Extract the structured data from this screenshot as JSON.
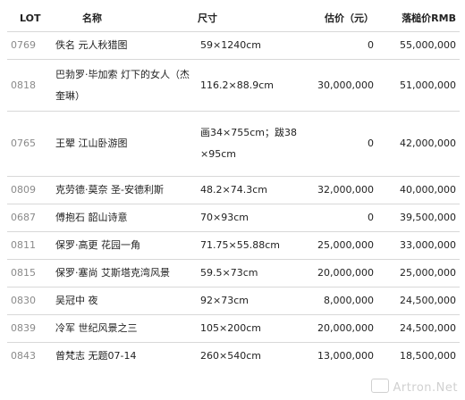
{
  "headers": {
    "lot": "LOT",
    "name": "名称",
    "size": "尺寸",
    "estimate": "估价（元）",
    "price": "落槌价RMB"
  },
  "rows": [
    {
      "lot": "0769",
      "name": "佚名 元人秋猎图",
      "size": "59×1240cm",
      "estimate": "0",
      "price": "55,000,000"
    },
    {
      "lot": "0818",
      "name": "巴勃罗·毕加索 灯下的女人（杰奎琳）",
      "size": "116.2×88.9cm",
      "estimate": "30,000,000",
      "price": "51,000,000"
    },
    {
      "lot": "0765",
      "name": "王翚 江山卧游图",
      "size": "画34×755cm；跋38×95cm",
      "estimate": "0",
      "price": "42,000,000"
    },
    {
      "lot": "0809",
      "name": "克劳德·莫奈 圣-安德利斯",
      "size": "48.2×74.3cm",
      "estimate": "32,000,000",
      "price": "40,000,000"
    },
    {
      "lot": "0687",
      "name": "傅抱石 韶山诗意",
      "size": "70×93cm",
      "estimate": "0",
      "price": "39,500,000"
    },
    {
      "lot": "0811",
      "name": "保罗·高更 花园一角",
      "size": "71.75×55.88cm",
      "estimate": "25,000,000",
      "price": "33,000,000"
    },
    {
      "lot": "0815",
      "name": "保罗·塞尚 艾斯塔克湾风景",
      "size": "59.5×73cm",
      "estimate": "20,000,000",
      "price": "25,000,000"
    },
    {
      "lot": "0830",
      "name": "吴冠中 夜",
      "size": "92×73cm",
      "estimate": "8,000,000",
      "price": "24,500,000"
    },
    {
      "lot": "0839",
      "name": "冷军 世纪风景之三",
      "size": "105×200cm",
      "estimate": "20,000,000",
      "price": "24,500,000"
    },
    {
      "lot": "0843",
      "name": "曾梵志 无题07-14",
      "size": "260×540cm",
      "estimate": "13,000,000",
      "price": "18,500,000"
    }
  ],
  "watermark": "Artron.Net"
}
